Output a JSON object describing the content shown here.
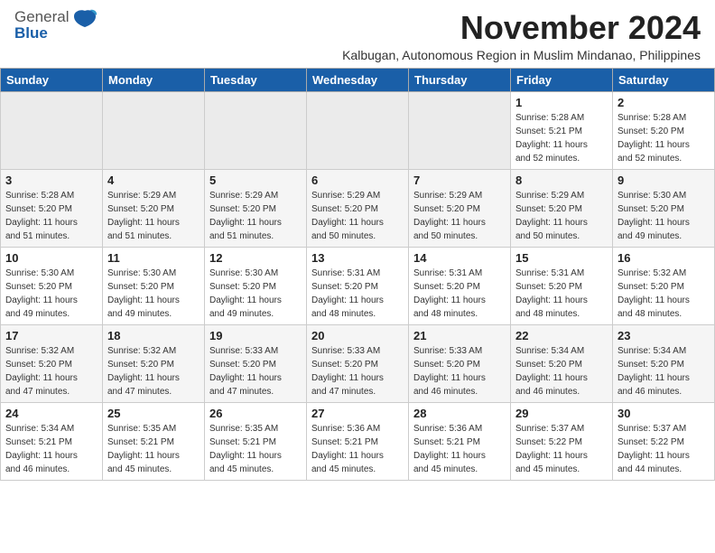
{
  "header": {
    "logo_general": "General",
    "logo_blue": "Blue",
    "month_title": "November 2024",
    "location": "Kalbugan, Autonomous Region in Muslim Mindanao, Philippines"
  },
  "weekdays": [
    "Sunday",
    "Monday",
    "Tuesday",
    "Wednesday",
    "Thursday",
    "Friday",
    "Saturday"
  ],
  "weeks": [
    [
      {
        "day": "",
        "info": ""
      },
      {
        "day": "",
        "info": ""
      },
      {
        "day": "",
        "info": ""
      },
      {
        "day": "",
        "info": ""
      },
      {
        "day": "",
        "info": ""
      },
      {
        "day": "1",
        "info": "Sunrise: 5:28 AM\nSunset: 5:21 PM\nDaylight: 11 hours\nand 52 minutes."
      },
      {
        "day": "2",
        "info": "Sunrise: 5:28 AM\nSunset: 5:20 PM\nDaylight: 11 hours\nand 52 minutes."
      }
    ],
    [
      {
        "day": "3",
        "info": "Sunrise: 5:28 AM\nSunset: 5:20 PM\nDaylight: 11 hours\nand 51 minutes."
      },
      {
        "day": "4",
        "info": "Sunrise: 5:29 AM\nSunset: 5:20 PM\nDaylight: 11 hours\nand 51 minutes."
      },
      {
        "day": "5",
        "info": "Sunrise: 5:29 AM\nSunset: 5:20 PM\nDaylight: 11 hours\nand 51 minutes."
      },
      {
        "day": "6",
        "info": "Sunrise: 5:29 AM\nSunset: 5:20 PM\nDaylight: 11 hours\nand 50 minutes."
      },
      {
        "day": "7",
        "info": "Sunrise: 5:29 AM\nSunset: 5:20 PM\nDaylight: 11 hours\nand 50 minutes."
      },
      {
        "day": "8",
        "info": "Sunrise: 5:29 AM\nSunset: 5:20 PM\nDaylight: 11 hours\nand 50 minutes."
      },
      {
        "day": "9",
        "info": "Sunrise: 5:30 AM\nSunset: 5:20 PM\nDaylight: 11 hours\nand 49 minutes."
      }
    ],
    [
      {
        "day": "10",
        "info": "Sunrise: 5:30 AM\nSunset: 5:20 PM\nDaylight: 11 hours\nand 49 minutes."
      },
      {
        "day": "11",
        "info": "Sunrise: 5:30 AM\nSunset: 5:20 PM\nDaylight: 11 hours\nand 49 minutes."
      },
      {
        "day": "12",
        "info": "Sunrise: 5:30 AM\nSunset: 5:20 PM\nDaylight: 11 hours\nand 49 minutes."
      },
      {
        "day": "13",
        "info": "Sunrise: 5:31 AM\nSunset: 5:20 PM\nDaylight: 11 hours\nand 48 minutes."
      },
      {
        "day": "14",
        "info": "Sunrise: 5:31 AM\nSunset: 5:20 PM\nDaylight: 11 hours\nand 48 minutes."
      },
      {
        "day": "15",
        "info": "Sunrise: 5:31 AM\nSunset: 5:20 PM\nDaylight: 11 hours\nand 48 minutes."
      },
      {
        "day": "16",
        "info": "Sunrise: 5:32 AM\nSunset: 5:20 PM\nDaylight: 11 hours\nand 48 minutes."
      }
    ],
    [
      {
        "day": "17",
        "info": "Sunrise: 5:32 AM\nSunset: 5:20 PM\nDaylight: 11 hours\nand 47 minutes."
      },
      {
        "day": "18",
        "info": "Sunrise: 5:32 AM\nSunset: 5:20 PM\nDaylight: 11 hours\nand 47 minutes."
      },
      {
        "day": "19",
        "info": "Sunrise: 5:33 AM\nSunset: 5:20 PM\nDaylight: 11 hours\nand 47 minutes."
      },
      {
        "day": "20",
        "info": "Sunrise: 5:33 AM\nSunset: 5:20 PM\nDaylight: 11 hours\nand 47 minutes."
      },
      {
        "day": "21",
        "info": "Sunrise: 5:33 AM\nSunset: 5:20 PM\nDaylight: 11 hours\nand 46 minutes."
      },
      {
        "day": "22",
        "info": "Sunrise: 5:34 AM\nSunset: 5:20 PM\nDaylight: 11 hours\nand 46 minutes."
      },
      {
        "day": "23",
        "info": "Sunrise: 5:34 AM\nSunset: 5:20 PM\nDaylight: 11 hours\nand 46 minutes."
      }
    ],
    [
      {
        "day": "24",
        "info": "Sunrise: 5:34 AM\nSunset: 5:21 PM\nDaylight: 11 hours\nand 46 minutes."
      },
      {
        "day": "25",
        "info": "Sunrise: 5:35 AM\nSunset: 5:21 PM\nDaylight: 11 hours\nand 45 minutes."
      },
      {
        "day": "26",
        "info": "Sunrise: 5:35 AM\nSunset: 5:21 PM\nDaylight: 11 hours\nand 45 minutes."
      },
      {
        "day": "27",
        "info": "Sunrise: 5:36 AM\nSunset: 5:21 PM\nDaylight: 11 hours\nand 45 minutes."
      },
      {
        "day": "28",
        "info": "Sunrise: 5:36 AM\nSunset: 5:21 PM\nDaylight: 11 hours\nand 45 minutes."
      },
      {
        "day": "29",
        "info": "Sunrise: 5:37 AM\nSunset: 5:22 PM\nDaylight: 11 hours\nand 45 minutes."
      },
      {
        "day": "30",
        "info": "Sunrise: 5:37 AM\nSunset: 5:22 PM\nDaylight: 11 hours\nand 44 minutes."
      }
    ]
  ]
}
